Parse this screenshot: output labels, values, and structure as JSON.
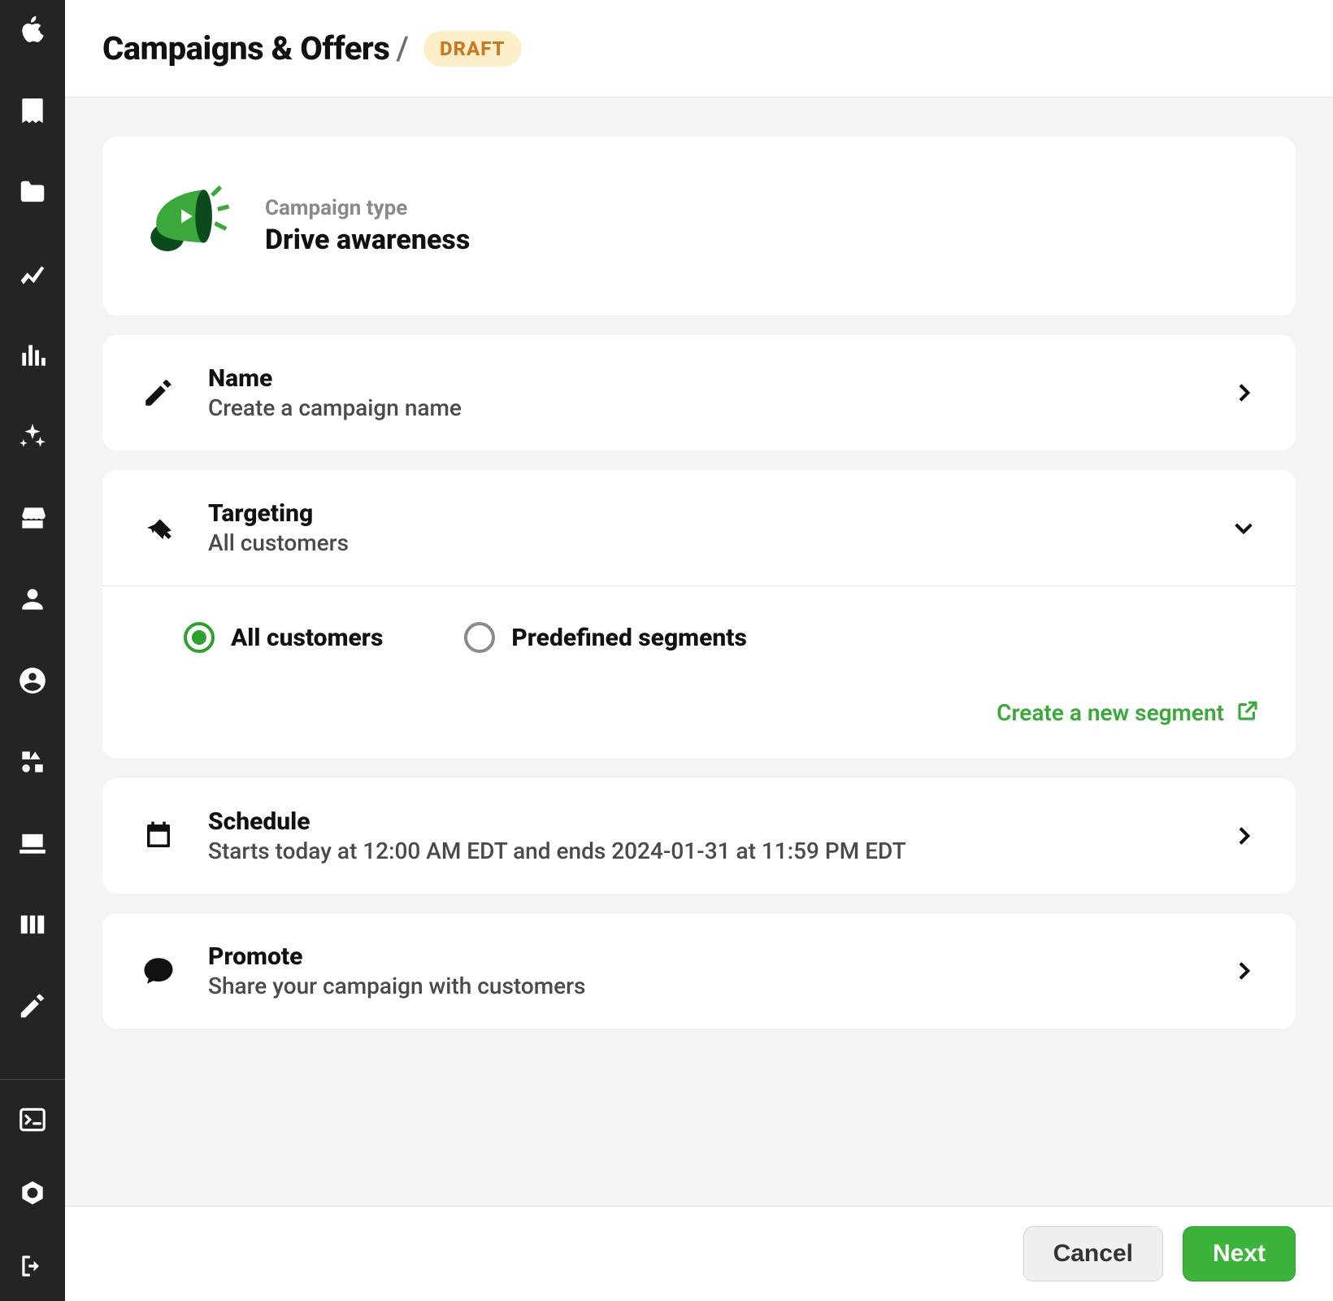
{
  "header": {
    "title": "Campaigns & Offers",
    "slash": "/",
    "status_badge": "DRAFT"
  },
  "campaign_type": {
    "label": "Campaign type",
    "value": "Drive awareness"
  },
  "name_section": {
    "title": "Name",
    "subtitle": "Create a campaign name"
  },
  "targeting_section": {
    "title": "Targeting",
    "subtitle": "All customers",
    "options": {
      "all_customers": "All customers",
      "predefined_segments": "Predefined segments"
    },
    "create_segment_link": "Create a new segment"
  },
  "schedule_section": {
    "title": "Schedule",
    "subtitle": "Starts today at 12:00 AM EDT and ends 2024-01-31 at 11:59 PM EDT"
  },
  "promote_section": {
    "title": "Promote",
    "subtitle": "Share your campaign with customers"
  },
  "footer": {
    "cancel": "Cancel",
    "next": "Next"
  },
  "sidebar_icons": [
    "apple-icon",
    "receipt-icon",
    "folder-icon",
    "line-chart-icon",
    "bar-chart-icon",
    "sparkle-icon",
    "store-icon",
    "person-icon",
    "account-circle-icon",
    "shapes-icon",
    "laptop-icon",
    "columns-icon",
    "pencil-icon"
  ],
  "sidebar_bottom_icons": [
    "terminal-icon",
    "settings-icon",
    "logout-icon"
  ]
}
